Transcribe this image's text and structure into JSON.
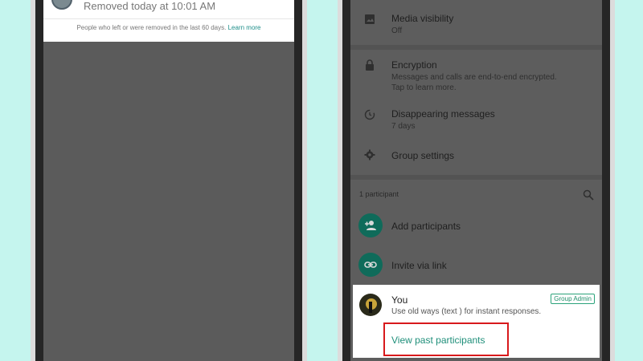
{
  "left_screen": {
    "removed_text": "Removed today at 10:01 AM",
    "note": "People who left or were removed in the last 60 days.",
    "learn_more": "Learn more"
  },
  "right_screen": {
    "media_visibility": {
      "title": "Media visibility",
      "value": "Off",
      "icon": "image-icon"
    },
    "encryption": {
      "title": "Encryption",
      "line1": "Messages and calls are end-to-end encrypted.",
      "line2": "Tap to learn more.",
      "icon": "lock-icon"
    },
    "disappearing": {
      "title": "Disappearing messages",
      "value": "7 days",
      "icon": "timer-icon"
    },
    "group_settings": {
      "title": "Group settings",
      "icon": "gear-icon"
    },
    "participants_count": "1 participant",
    "add_participants": "Add participants",
    "invite_via_link": "Invite via link",
    "you": {
      "name": "You",
      "status": "Use old ways (text ) for instant responses.",
      "badge": "Group Admin"
    },
    "view_past": "View past participants"
  },
  "colors": {
    "background": "#c5f5ee",
    "accent": "#1f8f7a",
    "highlight": "#d8191c"
  }
}
